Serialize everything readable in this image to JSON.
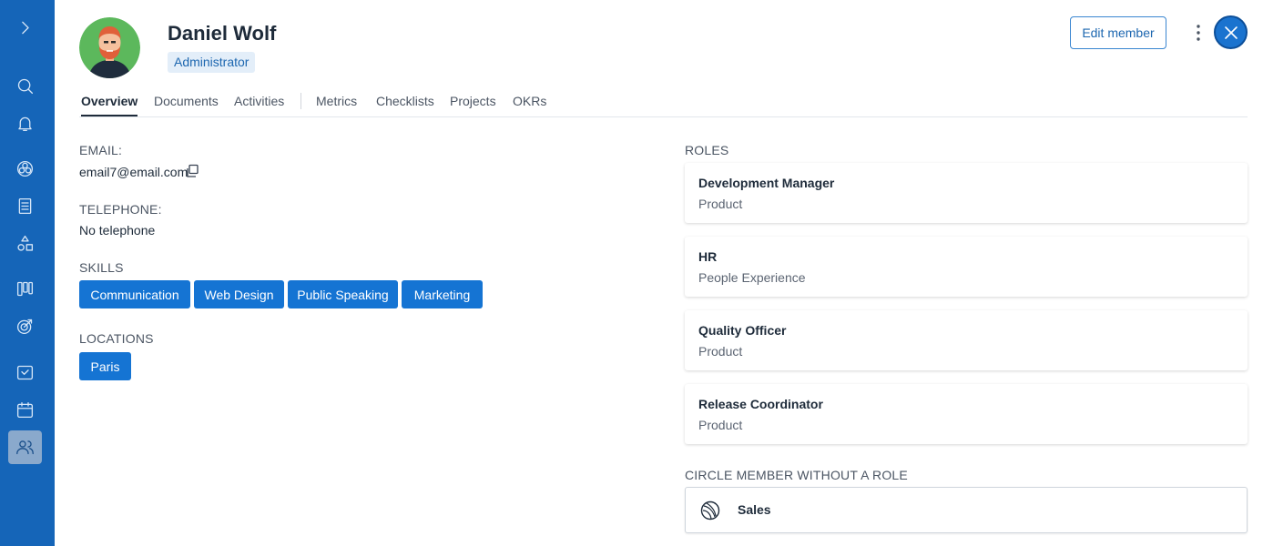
{
  "sidebar": {
    "items": [
      {
        "icon": "chevron-right-icon"
      },
      {
        "icon": "search-icon"
      },
      {
        "icon": "bell-icon"
      },
      {
        "icon": "circles-icon"
      },
      {
        "icon": "document-list-icon"
      },
      {
        "icon": "shapes-icon"
      },
      {
        "icon": "kanban-icon"
      },
      {
        "icon": "target-icon"
      },
      {
        "icon": "inbox-check-icon"
      },
      {
        "icon": "calendar-icon"
      },
      {
        "icon": "users-icon",
        "active": true
      }
    ]
  },
  "member": {
    "name": "Daniel Wolf",
    "badge": "Administrator"
  },
  "header": {
    "edit_label": "Edit member"
  },
  "tabs": [
    {
      "label": "Overview",
      "active": true
    },
    {
      "label": "Documents"
    },
    {
      "label": "Activities"
    },
    {
      "label": "Metrics"
    },
    {
      "label": "Checklists"
    },
    {
      "label": "Projects"
    },
    {
      "label": "OKRs"
    }
  ],
  "details": {
    "email_label": "EMAIL:",
    "email_value": "email7@email.com",
    "telephone_label": "TELEPHONE:",
    "telephone_value": "No telephone",
    "skills_label": "SKILLS",
    "skills": [
      "Communication",
      "Web Design",
      "Public Speaking",
      "Marketing"
    ],
    "locations_label": "LOCATIONS",
    "locations": [
      "Paris"
    ]
  },
  "roles": {
    "label": "ROLES",
    "items": [
      {
        "title": "Development Manager",
        "circle": "Product"
      },
      {
        "title": "HR",
        "circle": "People Experience"
      },
      {
        "title": "Quality Officer",
        "circle": "Product"
      },
      {
        "title": "Release Coordinator",
        "circle": "Product"
      }
    ]
  },
  "circle_member": {
    "label": "CIRCLE MEMBER WITHOUT A ROLE",
    "name": "Sales"
  },
  "colors": {
    "sidebar": "#1565b8",
    "accent": "#1574d3",
    "badge_bg": "#e3eef9"
  }
}
